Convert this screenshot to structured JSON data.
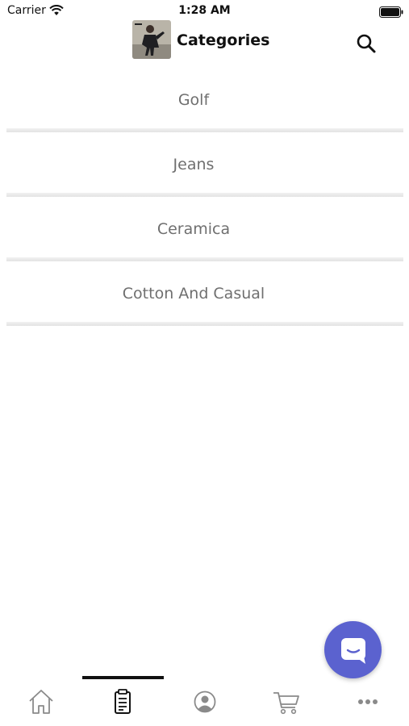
{
  "status_bar": {
    "carrier": "Carrier",
    "time": "1:28 AM"
  },
  "header": {
    "title": "Categories",
    "logo_icon": "store-logo",
    "search_icon": "search-icon"
  },
  "categories": [
    {
      "label": "Golf"
    },
    {
      "label": "Jeans"
    },
    {
      "label": "Ceramica"
    },
    {
      "label": "Cotton And Casual"
    }
  ],
  "chat": {
    "icon": "chat-icon",
    "color": "#5b62cf"
  },
  "tab_bar": {
    "active_tab": "categories",
    "tabs": [
      {
        "id": "home",
        "icon": "home-icon"
      },
      {
        "id": "categories",
        "icon": "clipboard-icon"
      },
      {
        "id": "profile",
        "icon": "user-icon"
      },
      {
        "id": "cart",
        "icon": "cart-icon"
      },
      {
        "id": "more",
        "icon": "more-icon"
      }
    ]
  }
}
